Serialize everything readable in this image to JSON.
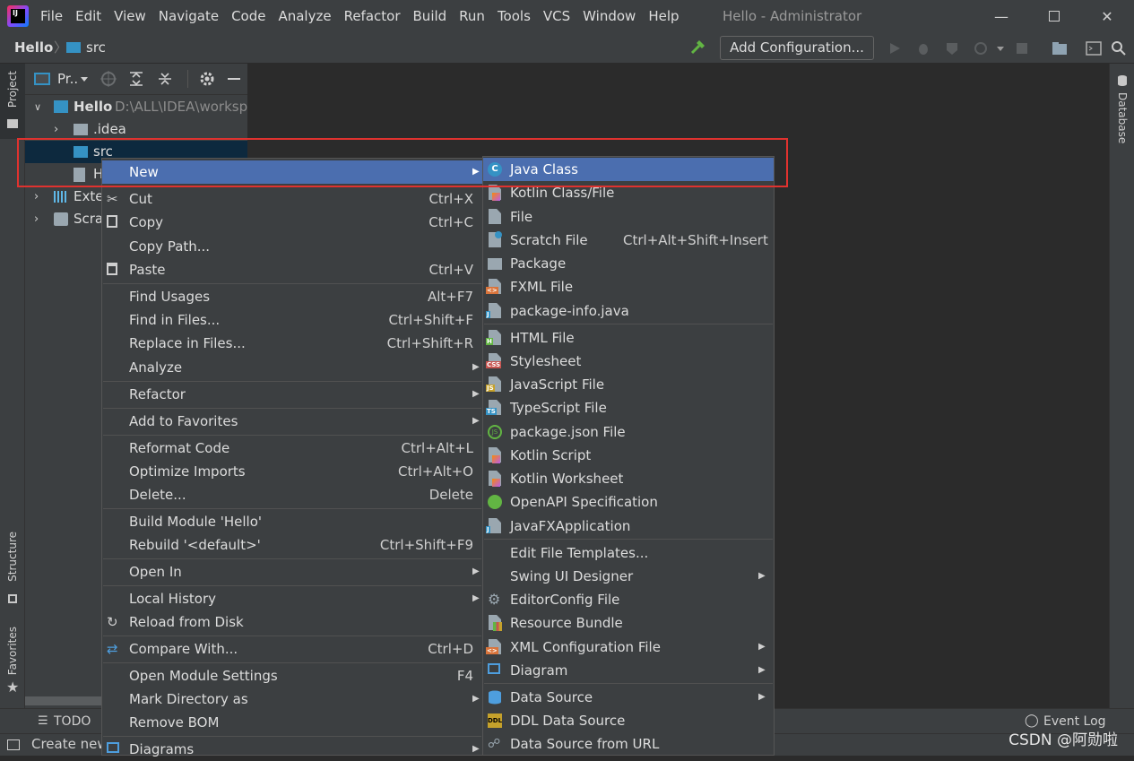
{
  "titlebar": {
    "menu": [
      "File",
      "Edit",
      "View",
      "Navigate",
      "Code",
      "Analyze",
      "Refactor",
      "Build",
      "Run",
      "Tools",
      "VCS",
      "Window",
      "Help"
    ],
    "window_title": "Hello - Administrator"
  },
  "navbar": {
    "crumb_project": "Hello",
    "crumb_folder": "src",
    "add_configuration": "Add Configuration..."
  },
  "left_strip": {
    "project": "Project",
    "structure": "Structure",
    "favorites": "Favorites"
  },
  "right_strip": {
    "database": "Database"
  },
  "project_panel": {
    "dropdown": "Pr..",
    "tree": {
      "root_name": "Hello",
      "root_path": "D:\\ALL\\IDEA\\worksp",
      "idea": ".idea",
      "src": "src",
      "iml": "H",
      "external": "Exte",
      "scratches": "Scra"
    }
  },
  "bottom": {
    "todo": "TODO",
    "event_log": "Event Log",
    "status": "Create new"
  },
  "context_menu": {
    "items": [
      {
        "label": "New",
        "shortcut": "",
        "submenu": true
      },
      {
        "label": "Cut",
        "shortcut": "Ctrl+X"
      },
      {
        "label": "Copy",
        "shortcut": "Ctrl+C"
      },
      {
        "label": "Copy Path...",
        "shortcut": ""
      },
      {
        "label": "Paste",
        "shortcut": "Ctrl+V"
      },
      {
        "label": "Find Usages",
        "shortcut": "Alt+F7"
      },
      {
        "label": "Find in Files...",
        "shortcut": "Ctrl+Shift+F"
      },
      {
        "label": "Replace in Files...",
        "shortcut": "Ctrl+Shift+R"
      },
      {
        "label": "Analyze",
        "shortcut": "",
        "submenu": true
      },
      {
        "label": "Refactor",
        "shortcut": "",
        "submenu": true
      },
      {
        "label": "Add to Favorites",
        "shortcut": "",
        "submenu": true
      },
      {
        "label": "Reformat Code",
        "shortcut": "Ctrl+Alt+L"
      },
      {
        "label": "Optimize Imports",
        "shortcut": "Ctrl+Alt+O"
      },
      {
        "label": "Delete...",
        "shortcut": "Delete"
      },
      {
        "label": "Build Module 'Hello'",
        "shortcut": ""
      },
      {
        "label": "Rebuild '<default>'",
        "shortcut": "Ctrl+Shift+F9"
      },
      {
        "label": "Open In",
        "shortcut": "",
        "submenu": true
      },
      {
        "label": "Local History",
        "shortcut": "",
        "submenu": true
      },
      {
        "label": "Reload from Disk",
        "shortcut": ""
      },
      {
        "label": "Compare With...",
        "shortcut": "Ctrl+D"
      },
      {
        "label": "Open Module Settings",
        "shortcut": "F4"
      },
      {
        "label": "Mark Directory as",
        "shortcut": "",
        "submenu": true
      },
      {
        "label": "Remove BOM",
        "shortcut": ""
      },
      {
        "label": "Diagrams",
        "shortcut": "",
        "submenu": true
      }
    ]
  },
  "new_submenu": {
    "items": [
      {
        "label": "Java Class",
        "shortcut": ""
      },
      {
        "label": "Kotlin Class/File",
        "shortcut": ""
      },
      {
        "label": "File",
        "shortcut": ""
      },
      {
        "label": "Scratch File",
        "shortcut": "Ctrl+Alt+Shift+Insert"
      },
      {
        "label": "Package",
        "shortcut": ""
      },
      {
        "label": "FXML File",
        "shortcut": ""
      },
      {
        "label": "package-info.java",
        "shortcut": ""
      },
      {
        "label": "HTML File",
        "shortcut": ""
      },
      {
        "label": "Stylesheet",
        "shortcut": ""
      },
      {
        "label": "JavaScript File",
        "shortcut": ""
      },
      {
        "label": "TypeScript File",
        "shortcut": ""
      },
      {
        "label": "package.json File",
        "shortcut": ""
      },
      {
        "label": "Kotlin Script",
        "shortcut": ""
      },
      {
        "label": "Kotlin Worksheet",
        "shortcut": ""
      },
      {
        "label": "OpenAPI Specification",
        "shortcut": ""
      },
      {
        "label": "JavaFXApplication",
        "shortcut": ""
      },
      {
        "label": "Edit File Templates...",
        "shortcut": ""
      },
      {
        "label": "Swing UI Designer",
        "shortcut": "",
        "submenu": true
      },
      {
        "label": "EditorConfig File",
        "shortcut": ""
      },
      {
        "label": "Resource Bundle",
        "shortcut": ""
      },
      {
        "label": "XML Configuration File",
        "shortcut": "",
        "submenu": true
      },
      {
        "label": "Diagram",
        "shortcut": "",
        "submenu": true
      },
      {
        "label": "Data Source",
        "shortcut": "",
        "submenu": true
      },
      {
        "label": "DDL Data Source",
        "shortcut": ""
      },
      {
        "label": "Data Source from URL",
        "shortcut": ""
      }
    ]
  },
  "watermark": "CSDN @阿勋啦"
}
